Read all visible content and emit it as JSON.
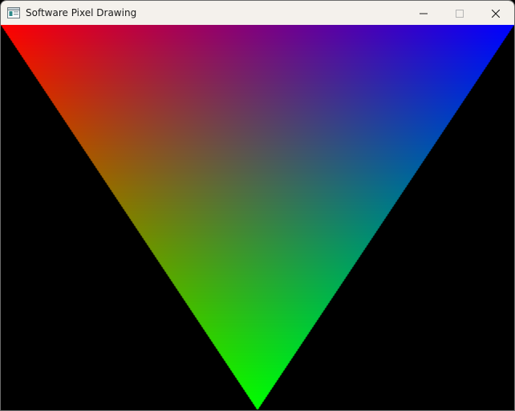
{
  "window": {
    "title": "Software Pixel Drawing",
    "minimize_icon": "minimize-icon",
    "maximize_icon": "maximize-icon",
    "close_icon": "close-icon",
    "app_icon": "window-app-icon"
  },
  "canvas": {
    "background": "#000000",
    "triangle": {
      "vertex_colors": {
        "top_left": "#ff0000",
        "top_right": "#0000ff",
        "bottom": "#00ff00"
      }
    }
  },
  "colors": {
    "titlebar": "#f4f1ec",
    "title_text": "#1b1b1b"
  }
}
